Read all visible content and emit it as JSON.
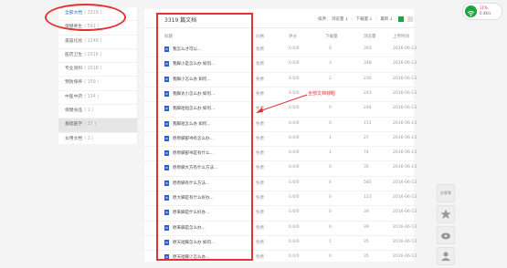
{
  "sidebar": {
    "items": [
      {
        "label": "全部文档",
        "count": "( 3319 )"
      },
      {
        "label": "保健养生",
        "count": "( 591 )"
      },
      {
        "label": "美容化妆",
        "count": "( 1249 )"
      },
      {
        "label": "医药卫生",
        "count": "( 2016 )"
      },
      {
        "label": "专业资料",
        "count": "( 2018 )"
      },
      {
        "label": "预防保养",
        "count": "( 159 )"
      },
      {
        "label": "中医中药",
        "count": "( 134 )"
      },
      {
        "label": "保健食品",
        "count": "( 1 )"
      },
      {
        "label": "基础医学",
        "count": "( 37 )"
      },
      {
        "label": "女用文档",
        "count": "( 1 )"
      }
    ]
  },
  "main": {
    "doc_count": "3319 篇文档",
    "sort": {
      "label": "排序：",
      "opt1": "浏览量",
      "opt2": "下载量",
      "opt3": "最新",
      "arrow": "↓"
    },
    "columns": {
      "title": "标题",
      "price": "价格",
      "score": "评分",
      "download": "下载量",
      "views": "浏览量",
      "date": "上传时间"
    },
    "rows": [
      {
        "title": "我怎么才可以...",
        "price": "免费",
        "score": "0.0/0",
        "dl": "0",
        "views": "393",
        "date": "2016-06-13"
      },
      {
        "title": "我脚小是怎么办 如何...",
        "price": "免费",
        "score": "0.0/0",
        "dl": "3",
        "views": "348",
        "date": "2016-06-13"
      },
      {
        "title": "我脚小怎么办 如何...",
        "price": "免费",
        "score": "0.0/0",
        "dl": "2",
        "views": "230",
        "date": "2016-06-13"
      },
      {
        "title": "我脚太小怎么办 如何...",
        "price": "免费",
        "score": "0.0/0",
        "dl": "0",
        "views": "243",
        "date": "2016-06-13"
      },
      {
        "title": "我脚短短怎么办 如何...",
        "price": "免费",
        "score": "0.0/0",
        "dl": "0",
        "views": "248",
        "date": "2016-06-13"
      },
      {
        "title": "我脚短怎么办 如何...",
        "price": "免费",
        "score": "0.0/0",
        "dl": "0",
        "views": "151",
        "date": "2016-06-13"
      },
      {
        "title": "原原脚部书有怎么办...",
        "price": "免费",
        "score": "0.0/0",
        "dl": "1",
        "views": "27",
        "date": "2016-06-13"
      },
      {
        "title": "原原脚部书是有什么...",
        "price": "免费",
        "score": "0.0/0",
        "dl": "1",
        "views": "74",
        "date": "2016-06-13"
      },
      {
        "title": "原原脚大方有什么方法...",
        "price": "免费",
        "score": "0.0/0",
        "dl": "0",
        "views": "35",
        "date": "2016-06-13"
      },
      {
        "title": "原原脚有什么方法...",
        "price": "免费",
        "score": "0.0/0",
        "dl": "4",
        "views": "580",
        "date": "2016-06-13"
      },
      {
        "title": "原大脚是有什么好办...",
        "price": "免费",
        "score": "0.0/0",
        "dl": "0",
        "views": "123",
        "date": "2016-06-13"
      },
      {
        "title": "原来脚是什么好办...",
        "price": "免费",
        "score": "0.0/0",
        "dl": "0",
        "views": "39",
        "date": "2016-06-13"
      },
      {
        "title": "原来脚是怎么办...",
        "price": "免费",
        "score": "0.0/0",
        "dl": "0",
        "views": "39",
        "date": "2016-06-13"
      },
      {
        "title": "原天短脚怎么办 如何...",
        "price": "免费",
        "score": "0.0/0",
        "dl": "1",
        "views": "35",
        "date": "2016-06-13"
      },
      {
        "title": "原天短脚少怎么办...",
        "price": "免费",
        "score": "0.0/0",
        "dl": "0",
        "views": "35",
        "date": "2016-06-13"
      }
    ]
  },
  "annotation": {
    "text": "全部文档标题"
  },
  "badge": {
    "line1": "11%",
    "line2": "0.4K/s"
  },
  "tools": {
    "share": "分享到"
  },
  "colors": {
    "accent": "#2b74c5",
    "highlight": "#e23333",
    "green": "#1aa63a",
    "file_icon": "#2f60c0"
  }
}
